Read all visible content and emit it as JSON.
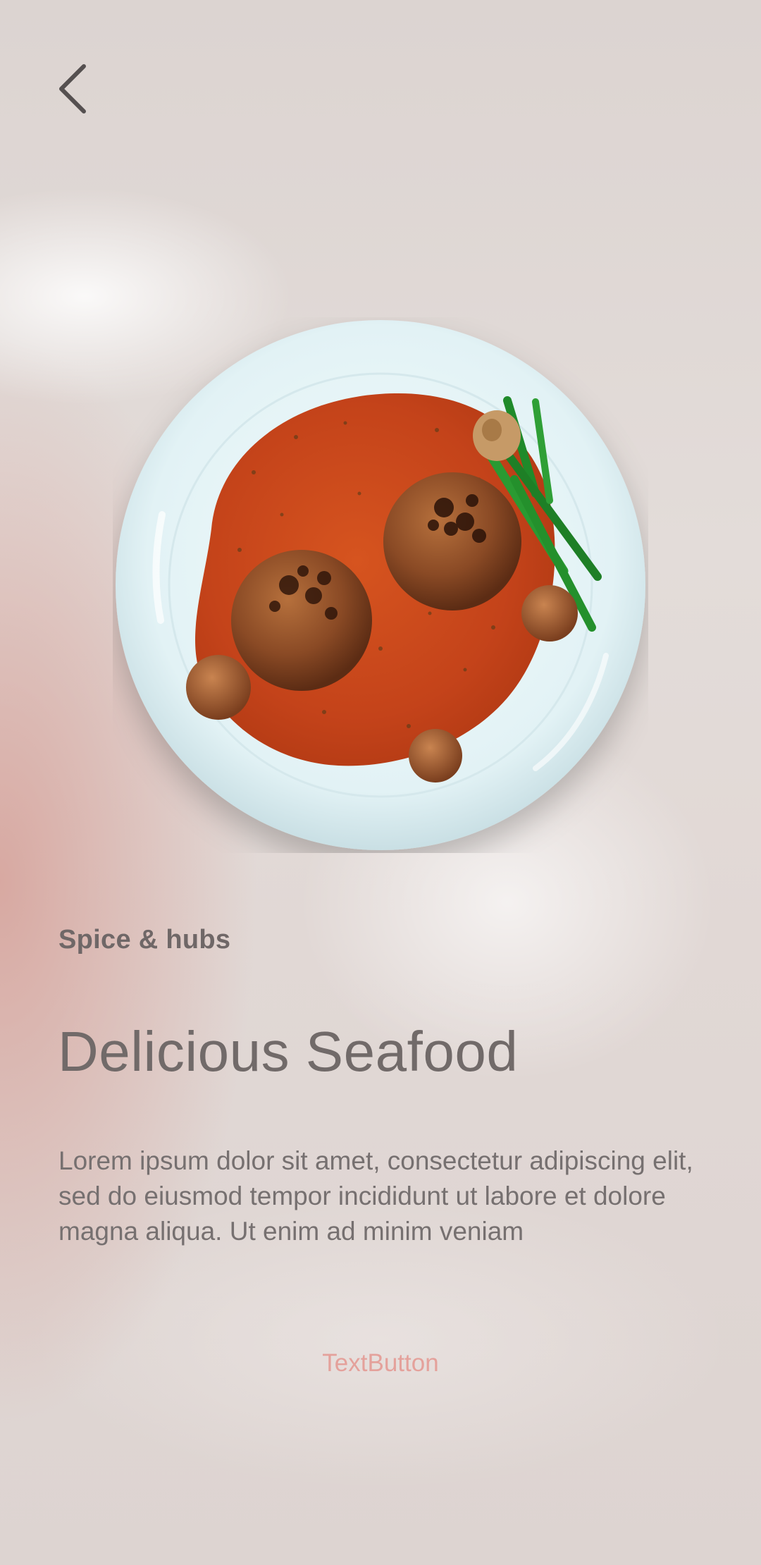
{
  "header": {
    "back_icon": "chevron-left-icon"
  },
  "hero": {
    "image": "plate-of-meatballs-in-tomato-sauce"
  },
  "content": {
    "category": "Spice & hubs",
    "title": "Delicious Seafood",
    "description": "Lorem ipsum dolor sit amet, consectetur adipiscing elit, sed do eiusmod tempor incididunt ut labore et dolore magna aliqua. Ut enim ad minim veniam"
  },
  "actions": {
    "text_button_label": "TextButton"
  },
  "colors": {
    "accent": "#e4a19b",
    "text_primary": "#716a69",
    "sauce": "#c9481a",
    "plate": "#e4f3f5"
  }
}
